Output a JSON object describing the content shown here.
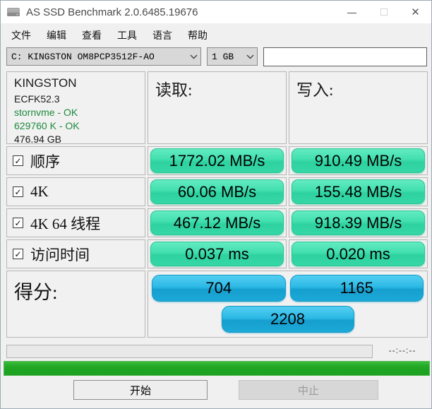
{
  "window": {
    "title": "AS SSD Benchmark 2.0.6485.19676",
    "minimize_glyph": "—",
    "close_glyph": "✕"
  },
  "menu": {
    "items": [
      "文件",
      "编辑",
      "查看",
      "工具",
      "语言",
      "帮助"
    ]
  },
  "toolbar": {
    "drive_combo": "C: KINGSTON OM8PCP3512F-AO",
    "size_combo": "1 GB",
    "test_input_value": ""
  },
  "drive_info": {
    "model": "KINGSTON",
    "firmware": "ECFK52.3",
    "driver_status": "stornvme - OK",
    "alignment_status": "629760 K - OK",
    "capacity": "476.94 GB"
  },
  "table": {
    "read_header": "读取:",
    "write_header": "写入:",
    "rows": [
      {
        "label": "顺序",
        "checked": true,
        "read": "1772.02 MB/s",
        "write": "910.49 MB/s"
      },
      {
        "label": "4K",
        "checked": true,
        "read": "60.06 MB/s",
        "write": "155.48 MB/s"
      },
      {
        "label": "4K 64 线程",
        "checked": true,
        "read": "467.12 MB/s",
        "write": "918.39 MB/s"
      },
      {
        "label": "访问时间",
        "checked": true,
        "read": "0.037 ms",
        "write": "0.020 ms"
      }
    ]
  },
  "score": {
    "label": "得分:",
    "read_score": "704",
    "write_score": "1165",
    "total_score": "2208"
  },
  "progress": {
    "time_remaining": "--:--:--"
  },
  "buttons": {
    "start": "开始",
    "abort": "中止"
  },
  "colors": {
    "result_pill_green": "#2fd3a1",
    "score_pill_blue": "#1fa9d7",
    "status_ok_green": "#1d8a3e",
    "progress_green": "#21a724",
    "titlebar_bg": "#ffffff",
    "window_bg": "#f0f0f0"
  },
  "checkbox_glyph": "✓"
}
